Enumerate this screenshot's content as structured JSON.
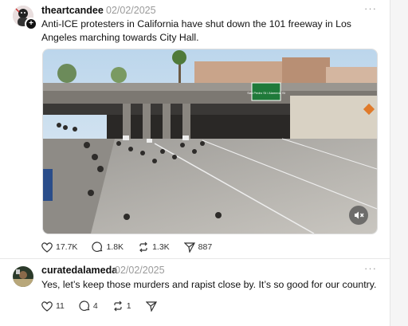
{
  "post1": {
    "username": "theartcandee",
    "date": "02/02/2025",
    "more": "···",
    "text": "Anti-ICE protesters in California have shut down the 101 freeway in Los Angeles marching towards City Hall.",
    "sign_text": "San Pedro St / Alameda St",
    "like_count": "17.7K",
    "reply_count": "1.8K",
    "repost_count": "1.3K",
    "share_count": "887"
  },
  "post2": {
    "username": "curatedalameda",
    "date": "02/02/2025",
    "more": "···",
    "text": "Yes, let’s keep those murders and rapist close by. It’s so good for our country.",
    "like_count": "11",
    "reply_count": "4",
    "repost_count": "1"
  },
  "icons": {
    "like": "heart-icon",
    "reply": "comment-icon",
    "repost": "repost-icon",
    "share": "send-icon",
    "mute": "speaker-muted-icon",
    "follow": "plus-icon"
  },
  "colors": {
    "text": "#111111",
    "muted": "#9a9a9a",
    "sign_green": "#1f7a3a"
  }
}
